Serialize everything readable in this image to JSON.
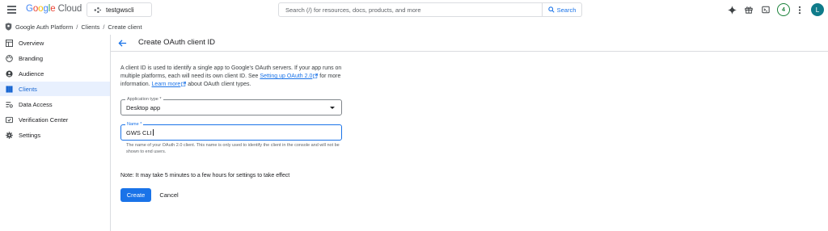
{
  "header": {
    "logo_brand": "Google",
    "logo_product": "Cloud",
    "project_name": "testgwscli",
    "search_placeholder": "Search (/) for resources, docs, products, and more",
    "search_button_label": "Search",
    "notifications_count": "4",
    "avatar_initial": "L",
    "icons": [
      "menu-icon",
      "project-dots-icon",
      "search-icon",
      "gemini-sparkle-icon",
      "gift-icon",
      "cloud-shell-icon",
      "more-vert-icon"
    ]
  },
  "breadcrumb": {
    "items": [
      "Google Auth Platform",
      "Clients",
      "Create client"
    ],
    "separator": "/"
  },
  "sidebar": {
    "items": [
      {
        "label": "Overview",
        "icon": "dashboard-icon"
      },
      {
        "label": "Branding",
        "icon": "palette-icon"
      },
      {
        "label": "Audience",
        "icon": "person-icon"
      },
      {
        "label": "Clients",
        "icon": "clients-icon",
        "active": true
      },
      {
        "label": "Data Access",
        "icon": "data-access-icon"
      },
      {
        "label": "Verification Center",
        "icon": "verification-icon"
      },
      {
        "label": "Settings",
        "icon": "gear-icon"
      }
    ]
  },
  "main": {
    "title": "Create OAuth client ID",
    "intro_part1": "A client ID is used to identify a single app to Google's OAuth servers. If your app runs on multiple platforms, each will need its own client ID. See ",
    "intro_link1": "Setting up OAuth 2.0",
    "intro_part2": " for more information. ",
    "intro_link2": "Learn more",
    "intro_part3": " about OAuth client types.",
    "app_type_label": "Application type *",
    "app_type_value": "Desktop app",
    "name_label": "Name *",
    "name_value": "GWS CLI",
    "name_helper": "The name of your OAuth 2.0 client. This name is only used to identify the client in the console and will not be shown to end users.",
    "note": "Note: It may take 5 minutes to a few hours for settings to take effect",
    "create_label": "Create",
    "cancel_label": "Cancel"
  },
  "colors": {
    "accent": "#1a73e8",
    "active_bg": "#e8f0fe",
    "badge_green": "#188038",
    "avatar_bg": "#0f7b8a"
  }
}
